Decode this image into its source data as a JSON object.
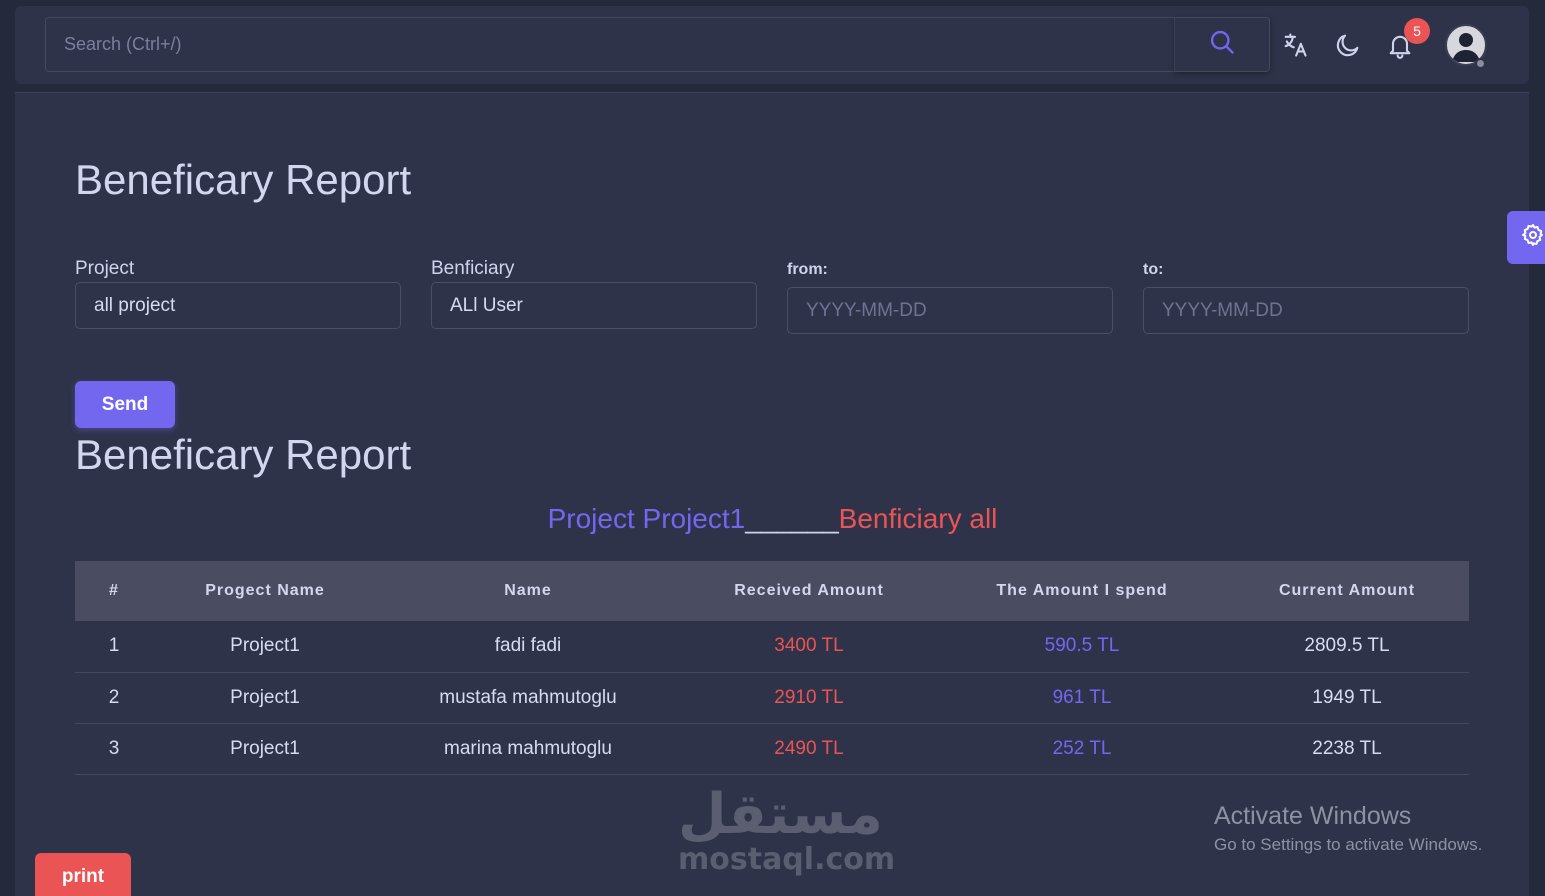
{
  "colors": {
    "accent": "#7367f0",
    "danger": "#ea5455",
    "bg": "#25293c",
    "card": "#2f3349"
  },
  "navbar": {
    "search_placeholder": "Search (Ctrl+/)",
    "notification_count": "5",
    "icons": [
      "search-icon",
      "translate-icon",
      "moon-icon",
      "bell-icon",
      "user-avatar"
    ]
  },
  "form": {
    "title": "Beneficary Report",
    "project_label": "Project",
    "project_value": "all project",
    "beneficiary_label": "Benficiary",
    "beneficiary_value": "ALl User",
    "from_label": "from:",
    "from_placeholder": "YYYY-MM-DD",
    "to_label": "to:",
    "to_placeholder": "YYYY-MM-DD",
    "send_label": "Send"
  },
  "report": {
    "title": "Beneficary Report",
    "subtitle_project": "Project Project1",
    "subtitle_separator": "______",
    "subtitle_beneficiary": "Benficiary all",
    "columns": [
      "#",
      "Progect Name",
      "Name",
      "Received Amount",
      "The Amount I spend",
      "Current Amount"
    ],
    "rows": [
      {
        "num": "1",
        "project": "Project1",
        "name": "fadi fadi",
        "received": "3400 TL",
        "spent": "590.5 TL",
        "current": "2809.5 TL"
      },
      {
        "num": "2",
        "project": "Project1",
        "name": "mustafa mahmutoglu",
        "received": "2910 TL",
        "spent": "961 TL",
        "current": "1949 TL"
      },
      {
        "num": "3",
        "project": "Project1",
        "name": "marina mahmutoglu",
        "received": "2490 TL",
        "spent": "252 TL",
        "current": "2238 TL"
      }
    ]
  },
  "print_label": "print",
  "watermark": {
    "arabic": "مستقل",
    "latin": "mostaql.com"
  },
  "activate_windows": {
    "title": "Activate Windows",
    "subtitle": "Go to Settings to activate Windows."
  }
}
